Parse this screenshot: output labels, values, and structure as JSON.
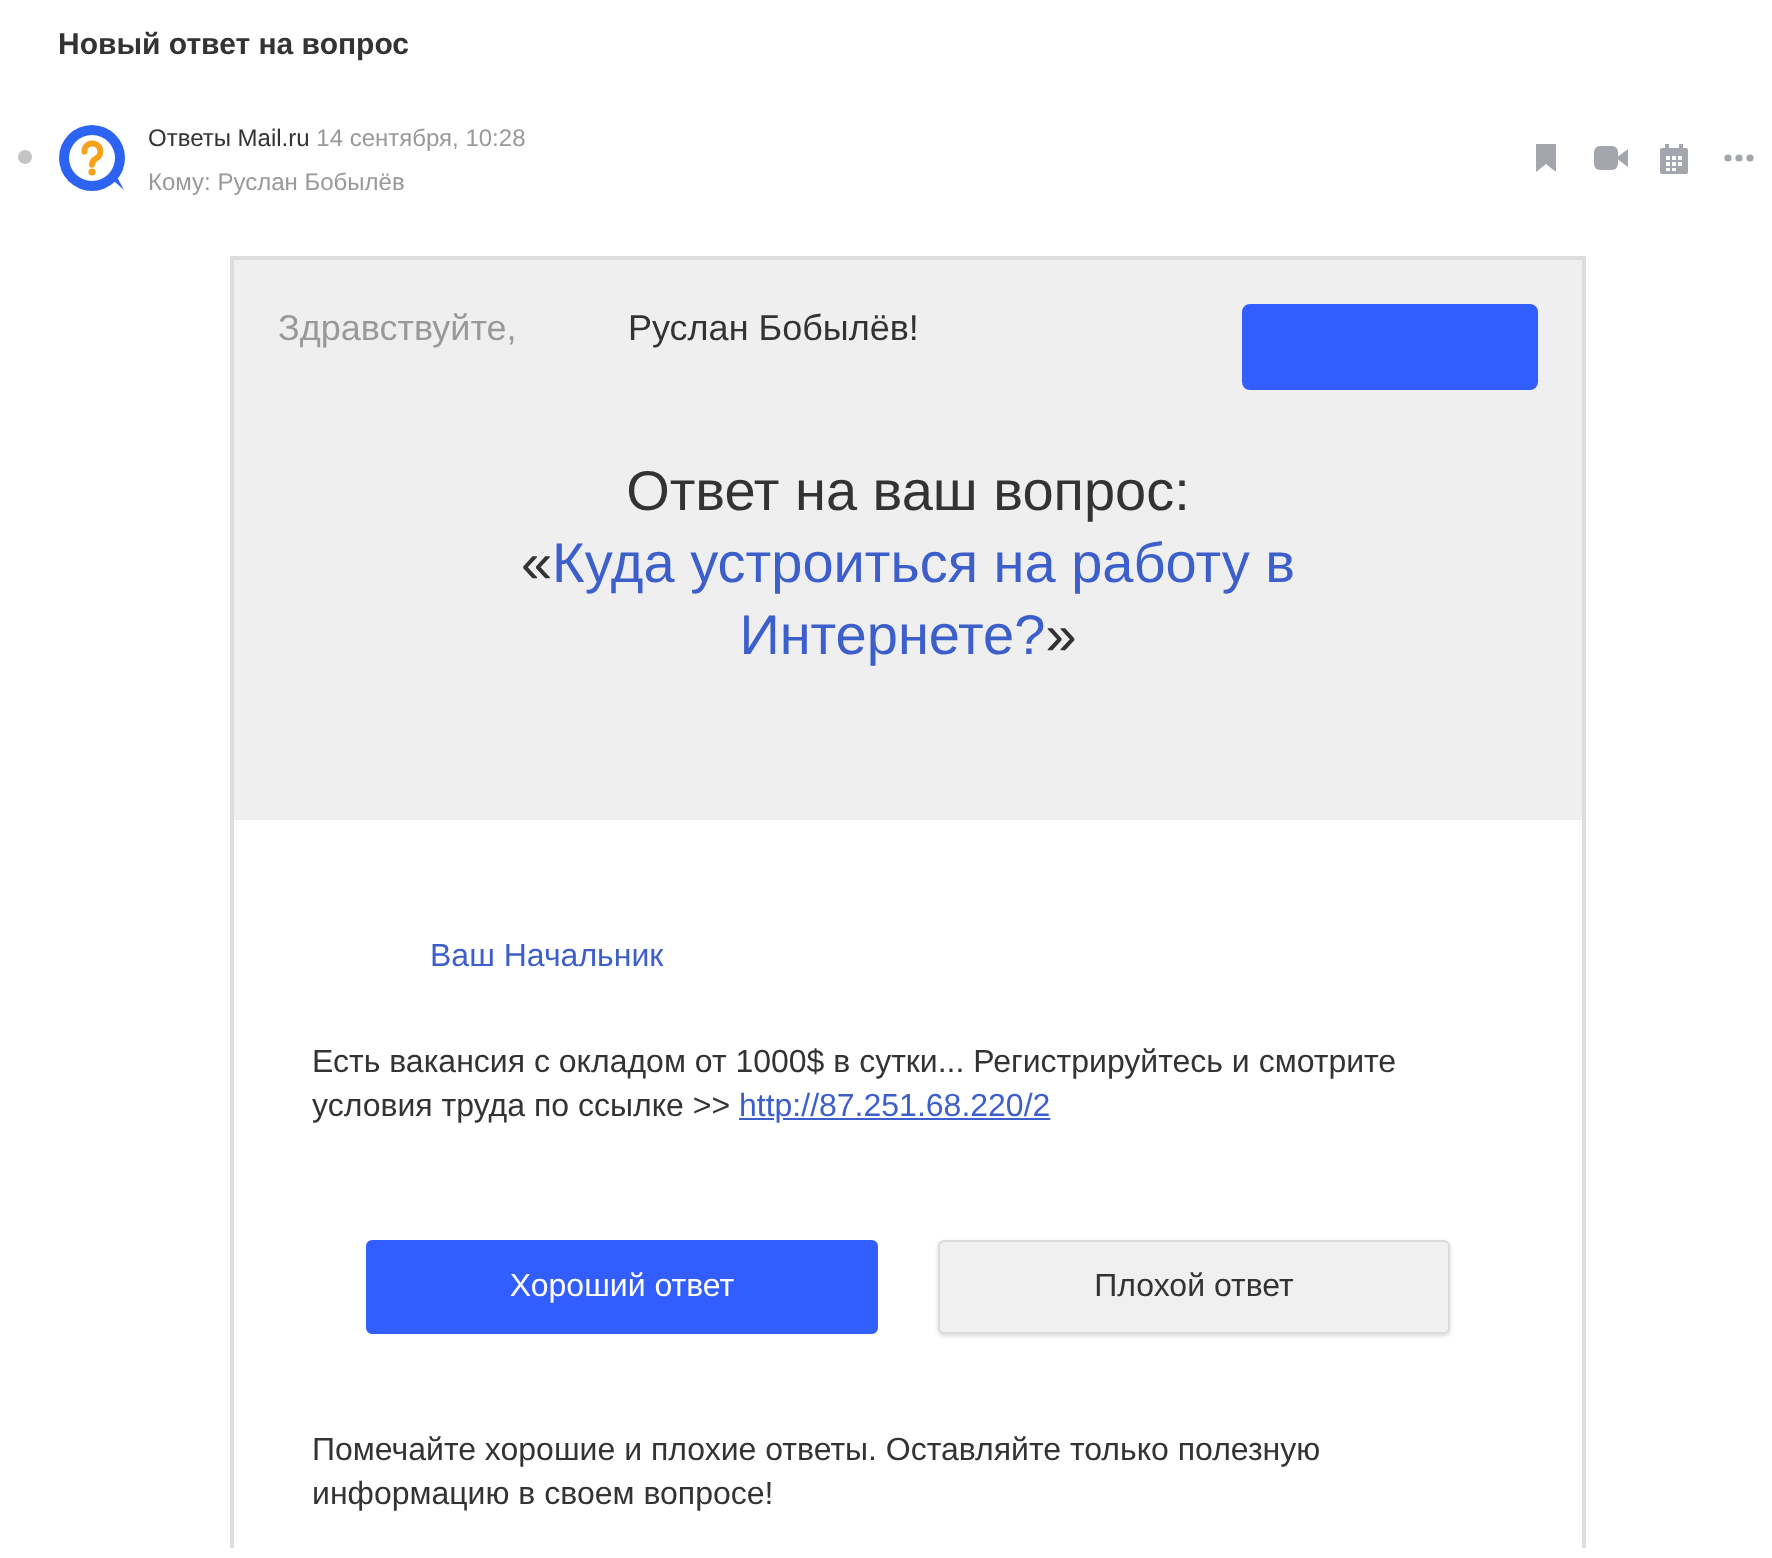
{
  "subject": "Новый ответ на вопрос",
  "message": {
    "read": true,
    "sender": "Ответы Mail.ru",
    "date": "14 сентября, 10:28",
    "to": "Кому: Руслан Бобылёв"
  },
  "email": {
    "greeting": "Здравствуйте,",
    "recipient": "Руслан Бобылёв!",
    "heading": "Ответ на ваш вопрос:",
    "question": {
      "open": "«",
      "text": "Куда устроиться на работу в Интернете?",
      "close": "»"
    },
    "author": "Ваш Начальник",
    "answer": {
      "text": "Есть вакансия с окладом от 1000$ в сутки... Регистрируйтесь и смотрите условия труда по ссылке >> ",
      "link": "http://87.251.68.220/2"
    },
    "buttons": [
      {
        "label": "Хороший ответ",
        "kind": "primary"
      },
      {
        "label": "Плохой ответ",
        "kind": "secondary"
      }
    ],
    "footer": "Помечайте хорошие и плохие ответы. Оставляйте только полезную информацию в своем вопросе!"
  }
}
